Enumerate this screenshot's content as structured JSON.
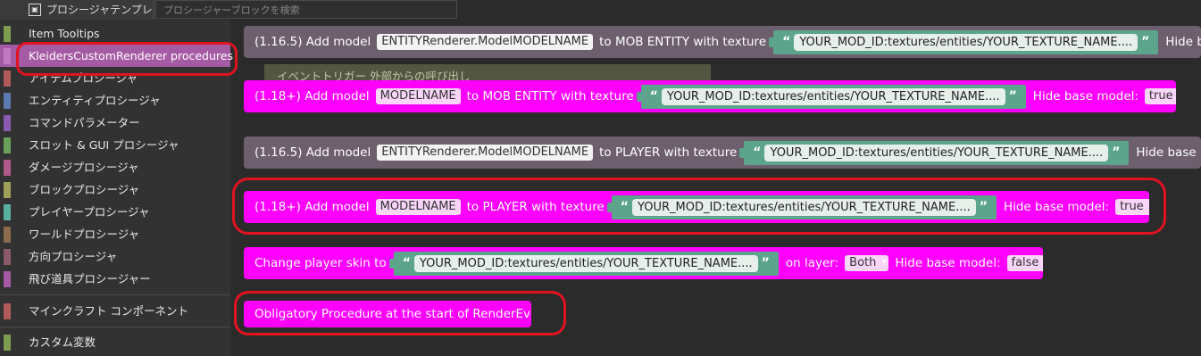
{
  "toolbar": {
    "templates_tab": "プロシージャテンプレート",
    "search_placeholder": "プロシージャーブロックを検索"
  },
  "sidebar": {
    "items": [
      {
        "label": "Item Tooltips",
        "color": "#7d9c52"
      },
      {
        "label": "KleidersCustomRenderer procedures",
        "color": "#a55aa4",
        "selected": true
      },
      {
        "label": "アイテムプロシージャ",
        "color": "#b05a5a"
      },
      {
        "label": "エンティティプロシージャ",
        "color": "#5a7ab0"
      },
      {
        "label": "コマンドパラメーター",
        "color": "#8a5ab0"
      },
      {
        "label": "スロット & GUI プロシージャ",
        "color": "#6aa05a"
      },
      {
        "label": "ダメージプロシージャ",
        "color": "#b05a8a"
      },
      {
        "label": "ブロックプロシージャ",
        "color": "#a0a05a"
      },
      {
        "label": "プレイヤープロシージャ",
        "color": "#5ab0a0"
      },
      {
        "label": "ワールドプロシージャ",
        "color": "#8a6a4a"
      },
      {
        "label": "方向プロシージャ",
        "color": "#8a5a6a"
      },
      {
        "label": "飛び道具プロシージャー",
        "color": "#a55aa4"
      },
      {
        "label": "マインクラフト コンポーネント",
        "color": "#b05a5a"
      },
      {
        "label": "カスタム変数",
        "color": "#7d9c52"
      }
    ]
  },
  "tooltip": "イベントトリガー 外部からの呼び出し",
  "blocks": {
    "b1": {
      "prefix": "(1.16.5) Add model",
      "field": "ENTITYRenderer.ModelMODELNAME",
      "mid": "to MOB ENTITY with texture",
      "texture": "YOUR_MOD_ID:textures/entities/YOUR_TEXTURE_NAME....",
      "suffix": "Hide b"
    },
    "b2": {
      "prefix": "(1.18+) Add model",
      "field": "MODELNAME",
      "mid": "to MOB ENTITY with texture",
      "texture": "YOUR_MOD_ID:textures/entities/YOUR_TEXTURE_NAME....",
      "suffix": "Hide base model:",
      "value": "true"
    },
    "b3": {
      "prefix": "(1.16.5) Add model",
      "field": "ENTITYRenderer.ModelMODELNAME",
      "mid": "to PLAYER with texture",
      "texture": "YOUR_MOD_ID:textures/entities/YOUR_TEXTURE_NAME....",
      "suffix": "Hide base"
    },
    "b4": {
      "prefix": "(1.18+) Add model",
      "field": "MODELNAME",
      "mid": "to PLAYER with texture",
      "texture": "YOUR_MOD_ID:textures/entities/YOUR_TEXTURE_NAME....",
      "suffix": "Hide base model:",
      "value": "true"
    },
    "b5": {
      "prefix": "Change player skin to",
      "texture": "YOUR_MOD_ID:textures/entities/YOUR_TEXTURE_NAME....",
      "mid": "on layer:",
      "layer": "Both",
      "suffix": "Hide base model:",
      "value": "false"
    },
    "b6": {
      "label": "Obligatory Procedure at the start of RenderEvent"
    }
  },
  "colors": {
    "highlight": "#e0131f",
    "magenta": "#ff00ff",
    "grey_block": "#6e5f6e",
    "string": "#5ca58c"
  }
}
